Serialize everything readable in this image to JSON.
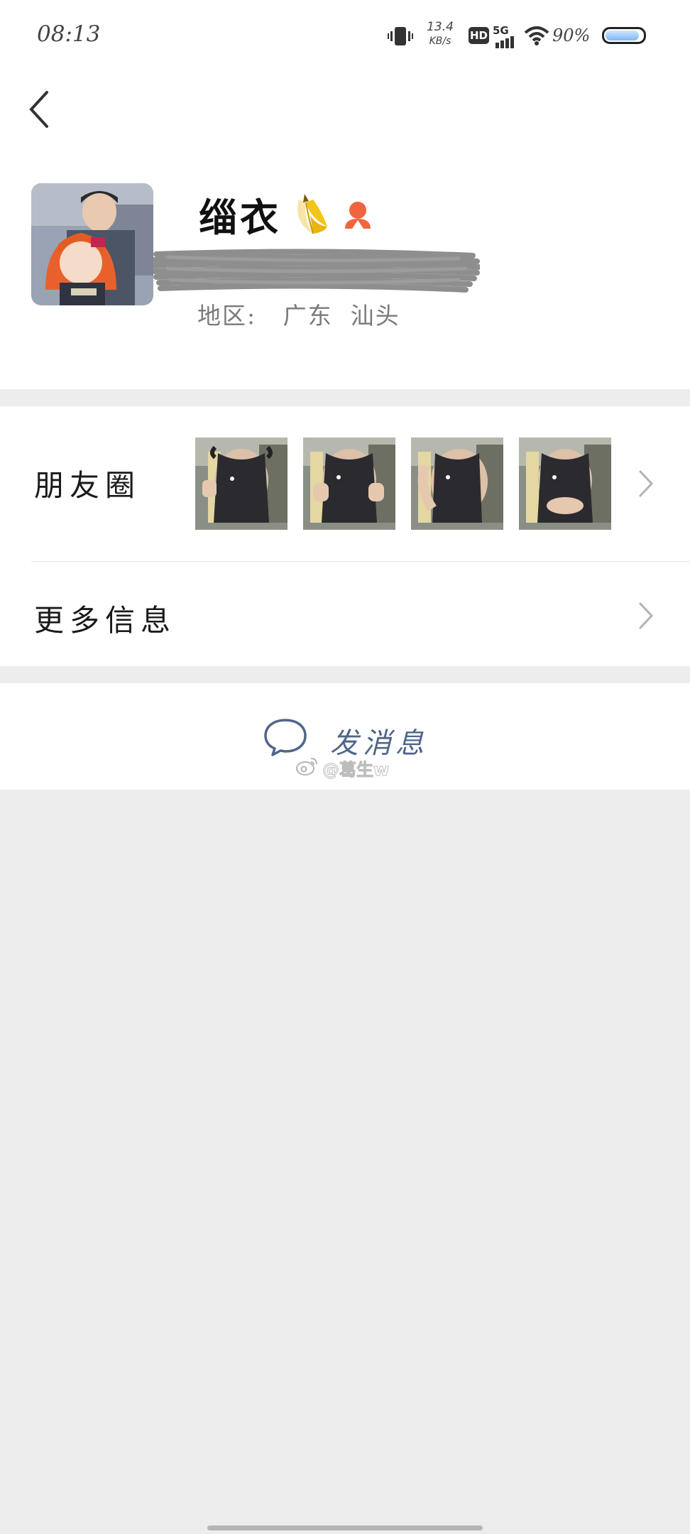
{
  "status_bar": {
    "time": "08:13",
    "net_speed_value": "13.4",
    "net_speed_unit": "KB/s",
    "hd_label": "HD",
    "network_label": "5G",
    "battery_percent": "90%",
    "battery_level": 0.9,
    "icons": [
      "vibrate-icon",
      "signal-icon",
      "wifi-icon",
      "battery-icon"
    ]
  },
  "header": {
    "back_icon": "chevron-left-icon"
  },
  "profile": {
    "nickname": "缁衣",
    "nickname_emoji": "banana-icon",
    "gender_icon": "female-user-icon",
    "region_label": "地区:",
    "region_value": "广东  汕头"
  },
  "list": {
    "moments_label": "朋友圈",
    "moments_thumbnail_count": 4,
    "more_info_label": "更多信息"
  },
  "actions": {
    "send_message_label": "发消息",
    "send_message_icon": "chat-bubble-icon"
  },
  "watermark": {
    "text": "@葛生w",
    "icon": "weibo-icon"
  },
  "colors": {
    "link_blue": "#4f6689",
    "page_bg": "#ededed",
    "card_bg": "#ffffff",
    "gender_female": "#f0643f"
  }
}
